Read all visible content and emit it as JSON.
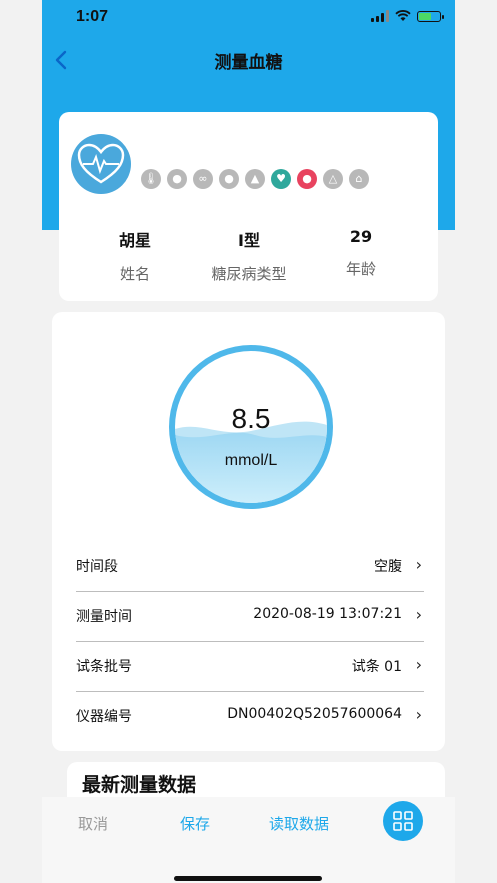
{
  "status": {
    "time": "1:07"
  },
  "nav": {
    "title": "测量血糖",
    "back_icon": "chevron-left-icon"
  },
  "profile": {
    "avatar_icon": "heart-pulse-icon",
    "tags": [
      {
        "icon": "thermometer-icon",
        "color": "#b8b8b8"
      },
      {
        "icon": "drop-icon",
        "color": "#b8b8b8"
      },
      {
        "icon": "lungs-icon",
        "color": "#b8b8b8"
      },
      {
        "icon": "drop-icon",
        "color": "#b8b8b8"
      },
      {
        "icon": "flask-icon",
        "color": "#b8b8b8"
      },
      {
        "icon": "heart-icon",
        "color": "#2fa89c"
      },
      {
        "icon": "blood-drop-icon",
        "color": "#e8435f"
      },
      {
        "icon": "triangle-icon",
        "color": "#b8b8b8"
      },
      {
        "icon": "house-icon",
        "color": "#b8b8b8"
      }
    ],
    "name_value": "胡星",
    "name_label": "姓名",
    "type_value": "I型",
    "type_label": "糖尿病类型",
    "age_value": "29",
    "age_label": "年龄"
  },
  "measurement": {
    "value": "8.5",
    "unit": "mmol/L",
    "fields": [
      {
        "label": "时间段",
        "value": "空腹"
      },
      {
        "label": "测量时间",
        "value": "2020-08-19 13:07:21"
      },
      {
        "label": "试条批号",
        "value": "试条 01"
      },
      {
        "label": "仪器编号",
        "value": "DN00402Q52057600064"
      }
    ]
  },
  "latest": {
    "title": "最新测量数据"
  },
  "bottom_bar": {
    "cancel": "取消",
    "save": "保存",
    "read": "读取数据",
    "grid_icon": "grid-icon"
  },
  "colors": {
    "primary": "#1ea8ea",
    "accent_red": "#e8435f",
    "accent_teal": "#2fa89c"
  }
}
